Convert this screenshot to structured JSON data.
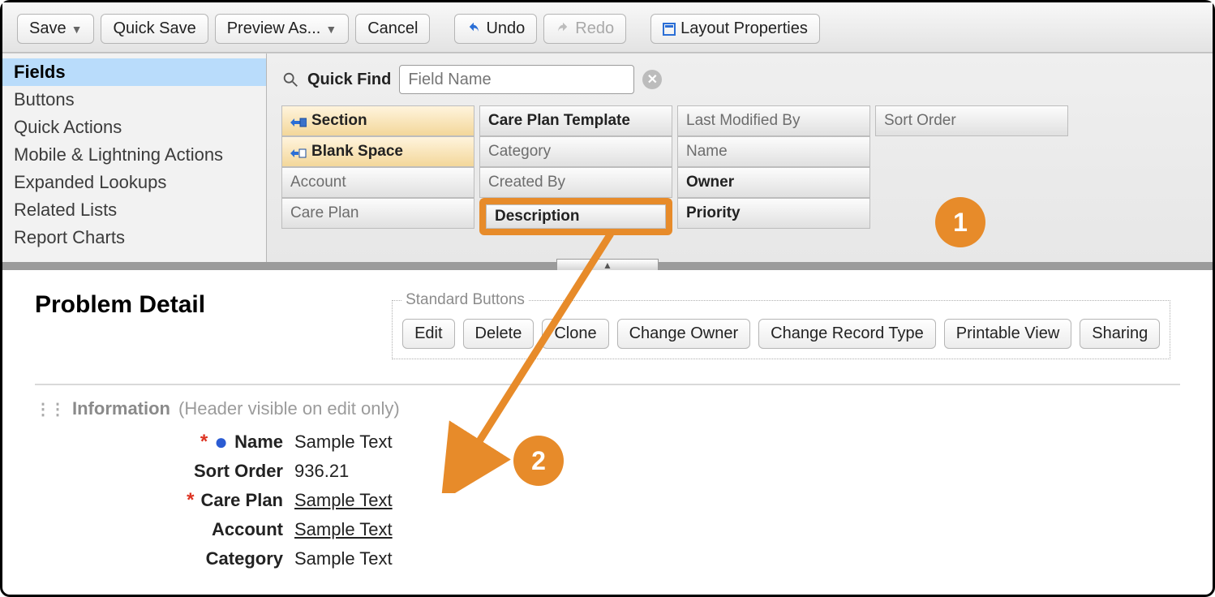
{
  "toolbar": {
    "save": "Save",
    "quick_save": "Quick Save",
    "preview_as": "Preview As...",
    "cancel": "Cancel",
    "undo": "Undo",
    "redo": "Redo",
    "layout_props": "Layout Properties"
  },
  "sidebar": {
    "items": [
      "Fields",
      "Buttons",
      "Quick Actions",
      "Mobile & Lightning Actions",
      "Expanded Lookups",
      "Related Lists",
      "Report Charts"
    ]
  },
  "quick_find": {
    "label": "Quick Find",
    "placeholder": "Field Name"
  },
  "palette": {
    "col0": [
      "Section",
      "Blank Space",
      "Account",
      "Care Plan"
    ],
    "col1": [
      "Care Plan Template",
      "Category",
      "Created By",
      "Description"
    ],
    "col2": [
      "Last Modified By",
      "Name",
      "Owner",
      "Priority"
    ],
    "col3": [
      "Sort Order"
    ]
  },
  "canvas": {
    "title": "Problem Detail",
    "std_buttons_legend": "Standard Buttons",
    "std_buttons": [
      "Edit",
      "Delete",
      "Clone",
      "Change Owner",
      "Change Record Type",
      "Printable View",
      "Sharing"
    ],
    "section_name": "Information",
    "section_note": "(Header visible on edit only)",
    "fields": [
      {
        "label": "Name",
        "value": "Sample Text",
        "required": true,
        "pk": true,
        "link": false
      },
      {
        "label": "Sort Order",
        "value": "936.21",
        "required": false,
        "pk": false,
        "link": false
      },
      {
        "label": "Care Plan",
        "value": "Sample Text",
        "required": true,
        "pk": false,
        "link": true
      },
      {
        "label": "Account",
        "value": "Sample Text",
        "required": false,
        "pk": false,
        "link": true
      },
      {
        "label": "Category",
        "value": "Sample Text",
        "required": false,
        "pk": false,
        "link": false
      }
    ]
  },
  "annotations": {
    "badge1": "1",
    "badge2": "2"
  }
}
